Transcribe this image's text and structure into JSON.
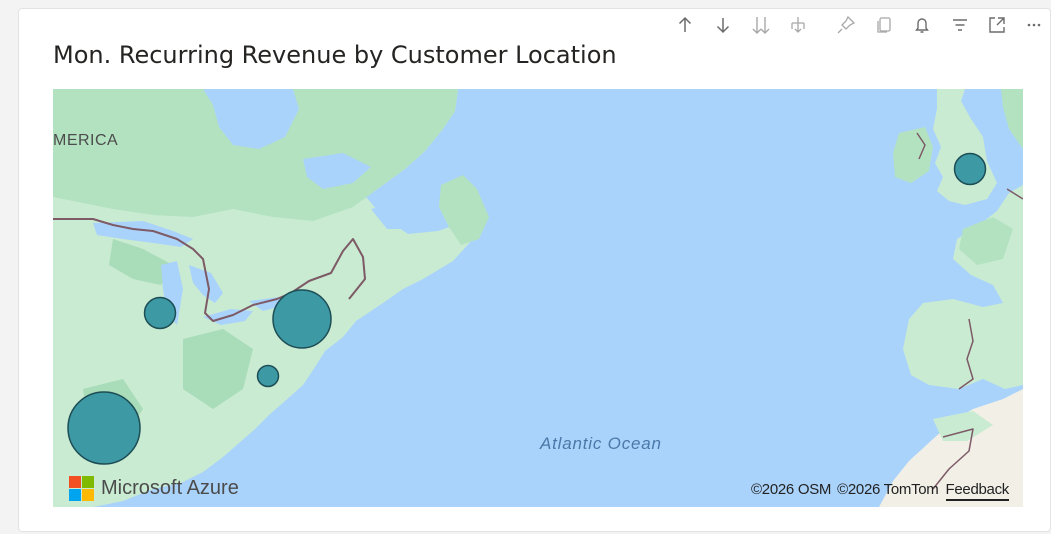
{
  "title": "Mon. Recurring Revenue by Customer Location",
  "toolbar": {
    "buttons": [
      {
        "name": "drill-up-icon"
      },
      {
        "name": "drill-down-icon"
      },
      {
        "name": "expand-all-icon"
      },
      {
        "name": "expand-hierarchy-icon"
      },
      {
        "name": "pin-icon"
      },
      {
        "name": "copy-icon"
      },
      {
        "name": "bell-icon"
      },
      {
        "name": "filter-icon"
      },
      {
        "name": "focus-mode-icon"
      },
      {
        "name": "more-options-icon"
      }
    ]
  },
  "map": {
    "continent_label": "MERICA",
    "ocean_label": "Atlantic Ocean",
    "brand": "Microsoft Azure",
    "attribution": {
      "osm": "©2026 OSM",
      "tomtom": "©2026 TomTom",
      "feedback": "Feedback"
    },
    "colors": {
      "water": "#aad3fb",
      "land": "#c9ebd2",
      "forest": "#a9dcb8",
      "bubble_fill": "#3d9aa5",
      "bubble_stroke": "#1d4d55",
      "border": "#7d5a66"
    }
  }
}
